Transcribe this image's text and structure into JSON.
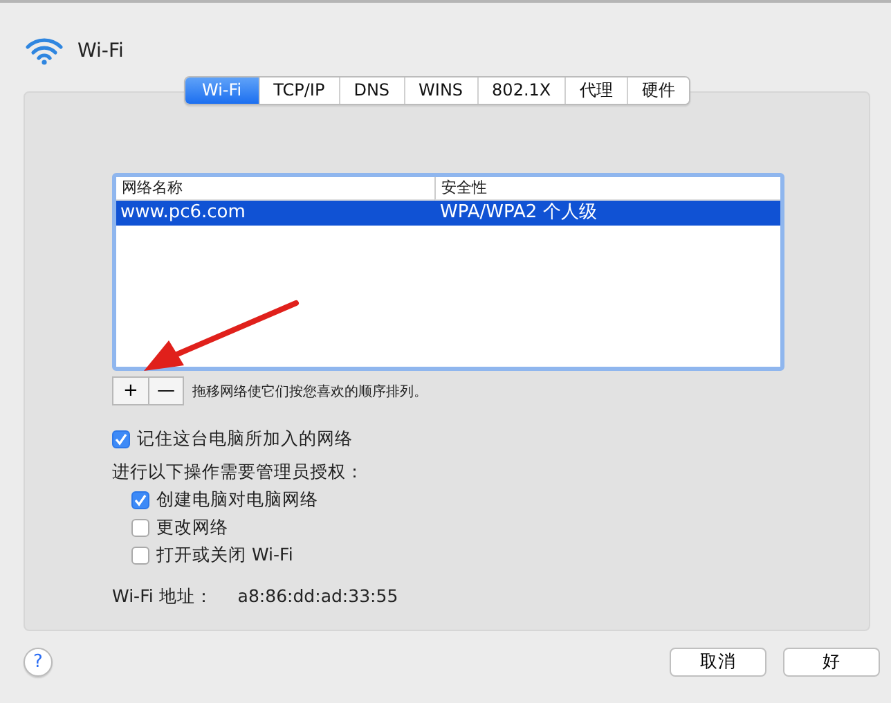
{
  "window": {
    "title": "Wi-Fi"
  },
  "tabs": [
    {
      "label": "Wi-Fi",
      "selected": true
    },
    {
      "label": "TCP/IP",
      "selected": false
    },
    {
      "label": "DNS",
      "selected": false
    },
    {
      "label": "WINS",
      "selected": false
    },
    {
      "label": "802.1X",
      "selected": false
    },
    {
      "label": "代理",
      "selected": false
    },
    {
      "label": "硬件",
      "selected": false
    }
  ],
  "table": {
    "columns": [
      "网络名称",
      "安全性"
    ],
    "rows": [
      {
        "cells": [
          "www.pc6.com",
          "WPA/WPA2 个人级"
        ],
        "selected": true
      }
    ]
  },
  "list_buttons": [
    "+",
    "—"
  ],
  "list_hint": "拖移网络使它们按您喜欢的顺序排列。",
  "remember": {
    "label": "记住这台电脑所加入的网络",
    "checked": true
  },
  "admin_heading": "进行以下操作需要管理员授权：",
  "admin_options": [
    {
      "label": "创建电脑对电脑网络",
      "checked": true
    },
    {
      "label": "更改网络",
      "checked": false
    },
    {
      "label": "打开或关闭 Wi-Fi",
      "checked": false
    }
  ],
  "address": {
    "label": "Wi-Fi 地址：",
    "value": "a8:86:dd:ad:33:55"
  },
  "help": "?",
  "buttons": [
    "取消",
    "好"
  ]
}
